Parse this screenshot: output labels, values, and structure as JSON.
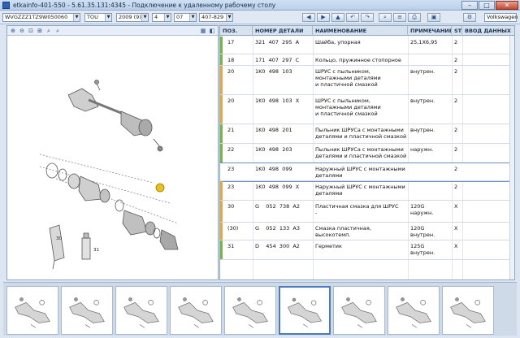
{
  "window": {
    "title": "etkainfo-401-550 - 5.61.35.131:4345 - Подключение к удаленному рабочему столу",
    "minimize": "–",
    "maximize": "□",
    "close": "✕"
  },
  "selection": {
    "vin": "WVGZZZ1TZ9W050060",
    "model": "TOU",
    "year": "2009 (9)",
    "group": "4",
    "subgroup": "07",
    "illustration": "407-829",
    "brand": "Volkswagen"
  },
  "table": {
    "headers": [
      "ПОЗ.",
      "НОМЕР ДЕТАЛИ",
      "НАИМЕНОВАНИЕ",
      "ПРИМЕЧАНИЕ",
      "ST",
      "ВВОД ДАННЫХ"
    ],
    "rows": [
      {
        "pos": "17",
        "part": "321  407  295  A",
        "name": "Шайба, упорная",
        "note": "25,1X6,95",
        "st": "2",
        "mark": "#7db544"
      },
      {
        "pos": "18",
        "part": "171  407  297  C",
        "name": "Кольцо, пружинное стопорное",
        "note": "",
        "st": "2",
        "mark": "#7db544"
      },
      {
        "pos": "20",
        "part": "1K0  498  103",
        "name": "ШРУС с пыльником,\nмонтажными деталями\nи пластичной смазкой",
        "note": "внутрен.",
        "st": "2",
        "mark": "#e6a93a"
      },
      {
        "pos": "20",
        "part": "1K0  498  103  X",
        "name": "ШРУС с пыльником,\nмонтажными деталями\nи пластичной смазкой",
        "note": "внутрен.",
        "st": "2",
        "mark": "#e6a93a"
      },
      {
        "pos": "21",
        "part": "1K0  498  201",
        "name": "Пыльник ШРУСа с монтажными\nдеталями и пластичной смазкой",
        "note": "внутрен.",
        "st": "2",
        "mark": "#7db544"
      },
      {
        "pos": "22",
        "part": "1K0  498  203",
        "name": "Пыльник ШРУСа с монтажными\nдеталями и пластичной смазкой",
        "note": "наружн.",
        "st": "2",
        "mark": "#7db544"
      },
      {
        "pos": "23",
        "part": "1K0  498  099",
        "name": "Наружный ШРУС с монтажными\nдеталями",
        "note": "",
        "st": "2",
        "mark": "",
        "selected": true
      },
      {
        "pos": "23",
        "part": "1K0  498  099  X",
        "name": "Наружный ШРУС с монтажными\nдеталями",
        "note": "",
        "st": "2",
        "mark": "#e6a93a"
      },
      {
        "pos": "30",
        "part": "G    052  738  A2",
        "name": "Пластичная смазка для ШРУС\n-",
        "note": "120G\nнаружн.",
        "st": "X",
        "mark": "#e6a93a"
      },
      {
        "pos": "(30)",
        "part": "G    052  133  A3",
        "name": "Смазка пластичная, высокотемп.",
        "note": "120G\nвнутрен.",
        "st": "X",
        "mark": "#e6a93a"
      },
      {
        "pos": "31",
        "part": "D    454  300  A2",
        "name": "Герметик",
        "note": "125G\nвнутрен.",
        "st": "X",
        "mark": "#7db544"
      }
    ]
  },
  "drawing": {
    "callouts": [
      "30",
      "31"
    ],
    "highlight_color": "#e8c21a"
  },
  "thumbnails": {
    "count": 9,
    "active_index": 5
  }
}
